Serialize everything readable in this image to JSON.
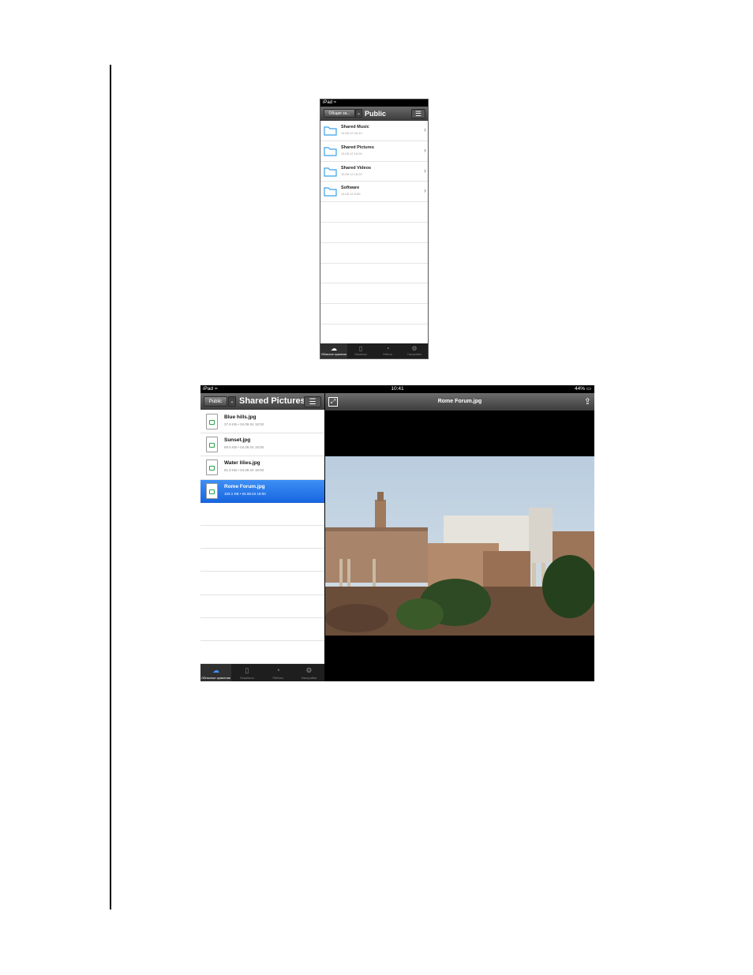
{
  "phone": {
    "status": "iPad",
    "back_label": "Общие за...",
    "title": "Public",
    "folders": [
      {
        "name": "Shared Music",
        "date": "14.05.12 16:10"
      },
      {
        "name": "Shared Pictures",
        "date": "15.05.12 16:20"
      },
      {
        "name": "Shared Videos",
        "date": "15.05.12 16:20"
      },
      {
        "name": "Software",
        "date": "14.05.12 6:50"
      }
    ],
    "tabs": [
      {
        "label": "Облачное хранение",
        "icon": "cloud-icon"
      },
      {
        "label": "Локально",
        "icon": "device-icon"
      },
      {
        "label": "Работа",
        "icon": "gauge-icon"
      },
      {
        "label": "Настройки",
        "icon": "gear-icon"
      }
    ]
  },
  "tablet": {
    "status_left": "iPad",
    "status_time": "10:41",
    "status_battery": "44%",
    "back_label": "Public",
    "title": "Shared Pictures",
    "files": [
      {
        "name": "Blue hills.jpg",
        "meta": "27.9 KB • 04.08.04 18:00",
        "selected": false
      },
      {
        "name": "Sunset.jpg",
        "meta": "69.5 KB • 04.08.04 18:00",
        "selected": false
      },
      {
        "name": "Water lilies.jpg",
        "meta": "81.8 KB • 04.08.04 18:00",
        "selected": false
      },
      {
        "name": "Rome Forum.jpg",
        "meta": "103.1 KB • 04.08.04 18:00",
        "selected": true
      }
    ],
    "viewer_title": "Rome Forum.jpg",
    "tabs": [
      {
        "label": "Облачное хранение",
        "icon": "cloud-icon"
      },
      {
        "label": "Локально",
        "icon": "device-icon"
      },
      {
        "label": "Работа",
        "icon": "gauge-icon"
      },
      {
        "label": "Настройки",
        "icon": "gear-icon"
      }
    ]
  },
  "colors": {
    "selection_blue": "#1866e0",
    "folder_blue": "#3aa0e8",
    "nav_dark": "#3c3c3c"
  }
}
